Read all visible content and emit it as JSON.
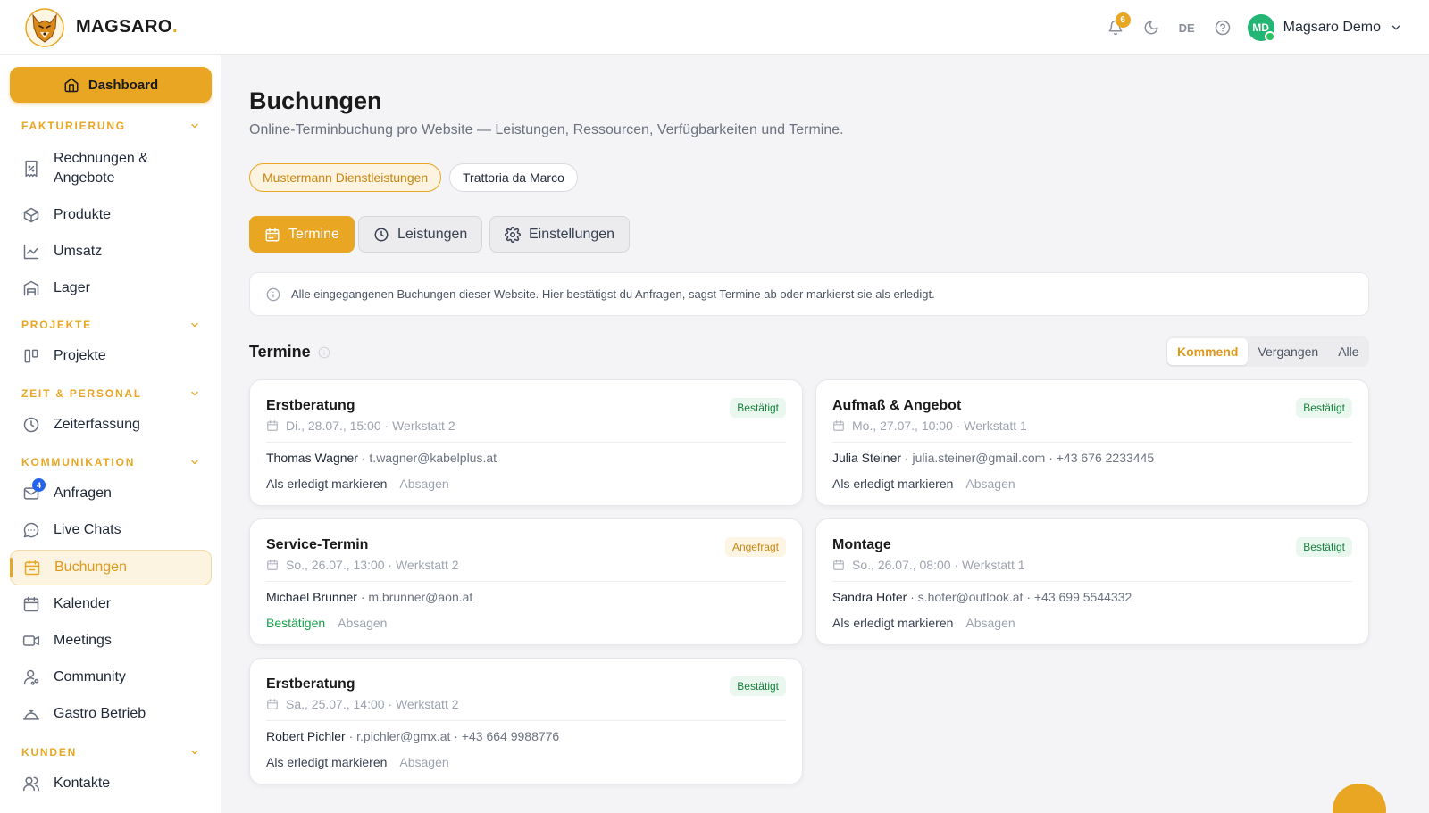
{
  "header": {
    "brand": "MAGSARO",
    "brand_dot": ".",
    "notif_count": "6",
    "lang": "DE",
    "user_initials": "MD",
    "user_name": "Magsaro Demo"
  },
  "sidebar": {
    "dashboard": "Dashboard",
    "sections": {
      "fakturierung": "FAKTURIERUNG",
      "projekte": "PROJEKTE",
      "zeit": "ZEIT & PERSONAL",
      "kommunikation": "KOMMUNIKATION",
      "kunden": "KUNDEN"
    },
    "items": {
      "rechnungen": "Rechnungen & Angebote",
      "produkte": "Produkte",
      "umsatz": "Umsatz",
      "lager": "Lager",
      "projekte": "Projekte",
      "zeiterfassung": "Zeiterfassung",
      "anfragen": "Anfragen",
      "anfragen_badge": "4",
      "live_chats": "Live Chats",
      "buchungen": "Buchungen",
      "kalender": "Kalender",
      "meetings": "Meetings",
      "community": "Community",
      "gastro": "Gastro Betrieb",
      "kontakte": "Kontakte"
    }
  },
  "main": {
    "title": "Buchungen",
    "subtitle": "Online-Terminbuchung pro Website — Leistungen, Ressourcen, Verfügbarkeiten und Termine.",
    "sites": [
      "Mustermann Dienstleistungen",
      "Trattoria da Marco"
    ],
    "tabs": [
      "Termine",
      "Leistungen",
      "Einstellungen"
    ],
    "info": "Alle eingegangenen Buchungen dieser Website. Hier bestätigst du Anfragen, sagst Termine ab oder markierst sie als erledigt.",
    "section_title": "Termine",
    "filters": [
      "Kommend",
      "Vergangen",
      "Alle"
    ],
    "cards": [
      {
        "title": "Erstberatung",
        "meta": "Di., 28.07., 15:00 · Werkstatt 2",
        "status": "Bestätigt",
        "name": "Thomas Wagner",
        "contact": " · t.wagner@kabelplus.at",
        "action": "Als erledigt markieren",
        "cancel": "Absagen"
      },
      {
        "title": "Aufmaß & Angebot",
        "meta": "Mo., 27.07., 10:00 · Werkstatt 1",
        "status": "Bestätigt",
        "name": "Julia Steiner",
        "contact": " · julia.steiner@gmail.com · +43 676 2233445",
        "action": "Als erledigt markieren",
        "cancel": "Absagen"
      },
      {
        "title": "Service-Termin",
        "meta": "So., 26.07., 13:00 · Werkstatt 2",
        "status": "Angefragt",
        "name": "Michael Brunner",
        "contact": " · m.brunner@aon.at",
        "action": "Bestätigen",
        "cancel": "Absagen"
      },
      {
        "title": "Montage",
        "meta": "So., 26.07., 08:00 · Werkstatt 1",
        "status": "Bestätigt",
        "name": "Sandra Hofer",
        "contact": " · s.hofer@outlook.at · +43 699 5544332",
        "action": "Als erledigt markieren",
        "cancel": "Absagen"
      },
      {
        "title": "Erstberatung",
        "meta": "Sa., 25.07., 14:00 · Werkstatt 2",
        "status": "Bestätigt",
        "name": "Robert Pichler",
        "contact": " · r.pichler@gmx.at · +43 664 9988776",
        "action": "Als erledigt markieren",
        "cancel": "Absagen"
      }
    ]
  },
  "colors": {
    "accent": "#e8a623",
    "confirmed": "#16803c",
    "requested": "#c9870f",
    "avatar": "#22b573",
    "badge_blue": "#2563eb"
  },
  "icons": {
    "logo": "wolf-logo",
    "notifications": "bell-icon",
    "theme": "moon-icon",
    "help": "help-circle-icon",
    "dashboard": "home-icon"
  }
}
